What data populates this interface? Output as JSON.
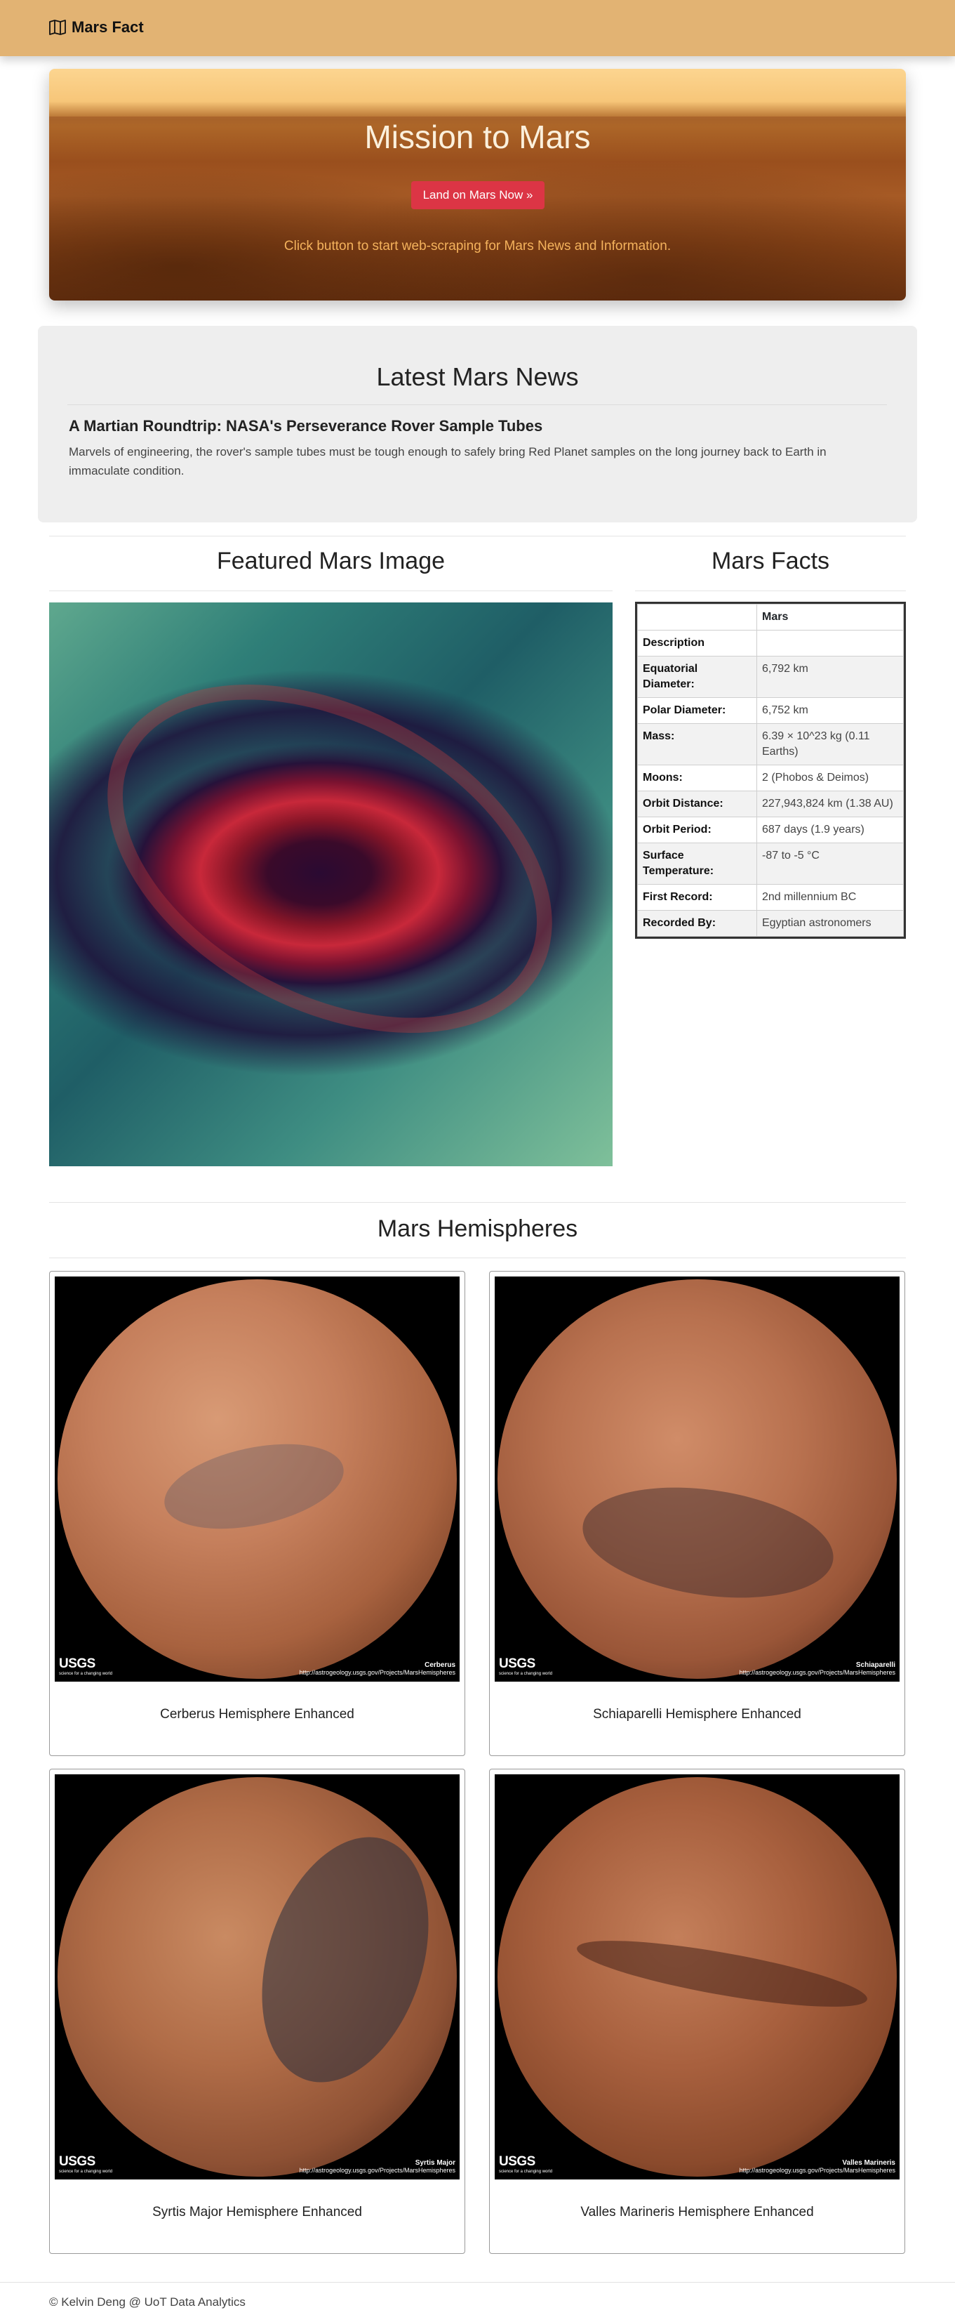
{
  "navbar": {
    "brand": "Mars Fact",
    "brand_icon": "map-icon"
  },
  "hero": {
    "title": "Mission to Mars",
    "button_label": "Land on Mars Now »",
    "subtitle": "Click button to start web-scraping for Mars News and Information."
  },
  "news": {
    "heading": "Latest Mars News",
    "title": "A Martian Roundtrip: NASA's Perseverance Rover Sample Tubes",
    "paragraph": "Marvels of engineering, the rover's sample tubes must be tough enough to safely bring Red Planet samples on the long journey back to Earth in immaculate condition."
  },
  "featured": {
    "heading": "Featured Mars Image"
  },
  "facts": {
    "heading": "Mars Facts",
    "column_header": "Mars",
    "rows": [
      {
        "label": "Description",
        "value": ""
      },
      {
        "label": "Equatorial Diameter:",
        "value": "6,792 km"
      },
      {
        "label": "Polar Diameter:",
        "value": "6,752 km"
      },
      {
        "label": "Mass:",
        "value": "6.39 × 10^23 kg (0.11 Earths)"
      },
      {
        "label": "Moons:",
        "value": "2 (Phobos & Deimos)"
      },
      {
        "label": "Orbit Distance:",
        "value": "227,943,824 km (1.38 AU)"
      },
      {
        "label": "Orbit Period:",
        "value": "687 days (1.9 years)"
      },
      {
        "label": "Surface Temperature:",
        "value": "-87 to -5 °C"
      },
      {
        "label": "First Record:",
        "value": "2nd millennium BC"
      },
      {
        "label": "Recorded By:",
        "value": "Egyptian astronomers"
      }
    ]
  },
  "hemispheres": {
    "heading": "Mars Hemispheres",
    "items": [
      {
        "caption": "Cerberus Hemisphere Enhanced",
        "image_label": "Cerberus"
      },
      {
        "caption": "Schiaparelli Hemisphere Enhanced",
        "image_label": "Schiaparelli"
      },
      {
        "caption": "Syrtis Major Hemisphere Enhanced",
        "image_label": "Syrtis Major"
      },
      {
        "caption": "Valles Marineris Hemisphere Enhanced",
        "image_label": "Valles Marineris"
      }
    ],
    "logo_text": "USGS",
    "logo_tagline": "science for a changing world",
    "credit_url": "http://astrogeology.usgs.gov/Projects/MarsHemispheres"
  },
  "footer": {
    "text": "© Kelvin Deng @ UoT Data Analytics"
  },
  "colors": {
    "navbar": "#e2b373",
    "button": "#dc3545",
    "hero_subtitle": "#f4b25c"
  }
}
